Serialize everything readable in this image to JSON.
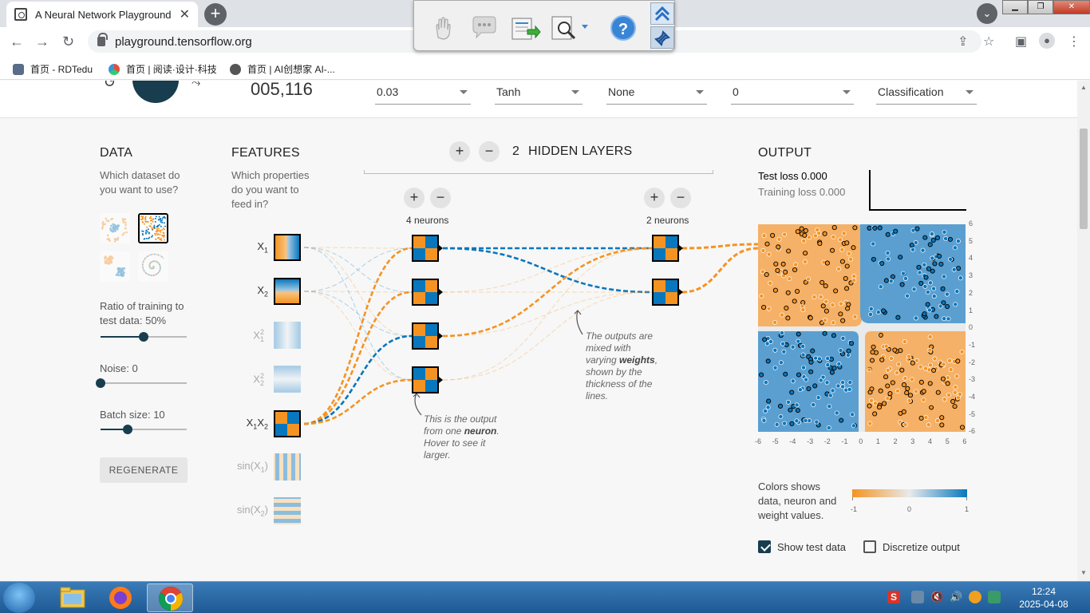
{
  "browser": {
    "tab_title": "A Neural Network Playground",
    "tab_close": "✕",
    "new_tab": "+",
    "url": "playground.tensorflow.org",
    "back": "←",
    "forward": "→",
    "reload": "↻",
    "bookmarks": [
      {
        "label": "首页 - RDTedu",
        "color": "#5a6d88"
      },
      {
        "label": "首页 | 阅读·设计·科技",
        "color": "#e0a030"
      },
      {
        "label": "首页 | AI创想家 AI-...",
        "color": "#555555"
      }
    ]
  },
  "overlay_toolbar": {
    "help": "?"
  },
  "top_controls": {
    "epoch": "005,116",
    "learning_rate": "0.03",
    "activation": "Tanh",
    "regularization": "None",
    "regularization_rate": "0",
    "problem_type": "Classification"
  },
  "data_panel": {
    "heading": "DATA",
    "question": "Which dataset do you want to use?",
    "ratio_label": "Ratio of training to test data:  50%",
    "ratio_value": 50,
    "noise_label": "Noise:  0",
    "noise_value": 0,
    "batch_label": "Batch size:  10",
    "batch_value": 10,
    "regenerate": "REGENERATE"
  },
  "features_panel": {
    "heading": "FEATURES",
    "question": "Which properties do you want to feed in?",
    "features": [
      {
        "base": "X",
        "sub": "1",
        "sup": "",
        "active": true
      },
      {
        "base": "X",
        "sub": "2",
        "sup": "",
        "active": true
      },
      {
        "base": "X",
        "sub": "1",
        "sup": "2",
        "active": false
      },
      {
        "base": "X",
        "sub": "2",
        "sup": "2",
        "active": false
      },
      {
        "base": "X",
        "sub": "1",
        "base2": "X",
        "sub2": "2",
        "active": true
      },
      {
        "base": "sin(X",
        "sub": "1",
        "close": ")",
        "active": false
      },
      {
        "base": "sin(X",
        "sub": "2",
        "close": ")",
        "active": false
      }
    ]
  },
  "network": {
    "plus": "+",
    "minus": "−",
    "hidden_layers_count": "2",
    "hidden_layers_label": "HIDDEN LAYERS",
    "layer1_neurons": "4 neurons",
    "layer2_neurons": "2 neurons",
    "note_neuron_pre": "This is the output from one ",
    "note_neuron_bold": "neuron",
    "note_neuron_post": ". Hover to see it larger.",
    "note_weights_pre": "The outputs are mixed with varying ",
    "note_weights_bold": "weights",
    "note_weights_post": ", shown by the thickness of the lines."
  },
  "output_panel": {
    "heading": "OUTPUT",
    "test_loss": "Test loss 0.000",
    "training_loss": "Training loss 0.000",
    "y_ticks": [
      "6",
      "5",
      "4",
      "3",
      "2",
      "1",
      "0",
      "-1",
      "-2",
      "-3",
      "-4",
      "-5",
      "-6"
    ],
    "x_ticks": [
      "-6",
      "-5",
      "-4",
      "-3",
      "-2",
      "-1",
      "0",
      "1",
      "2",
      "3",
      "4",
      "5",
      "6"
    ],
    "legend_text": "Colors shows data, neuron and weight values.",
    "legend_min": "-1",
    "legend_mid": "0",
    "legend_max": "1",
    "show_test_data": "Show test data",
    "show_test_data_checked": true,
    "discretize_output": "Discretize output",
    "discretize_output_checked": false
  },
  "colors": {
    "orange": "#f59322",
    "blue": "#0877bd",
    "dark": "#183d4e"
  },
  "taskbar": {
    "time": "12:24",
    "date": "2025-04-08"
  }
}
